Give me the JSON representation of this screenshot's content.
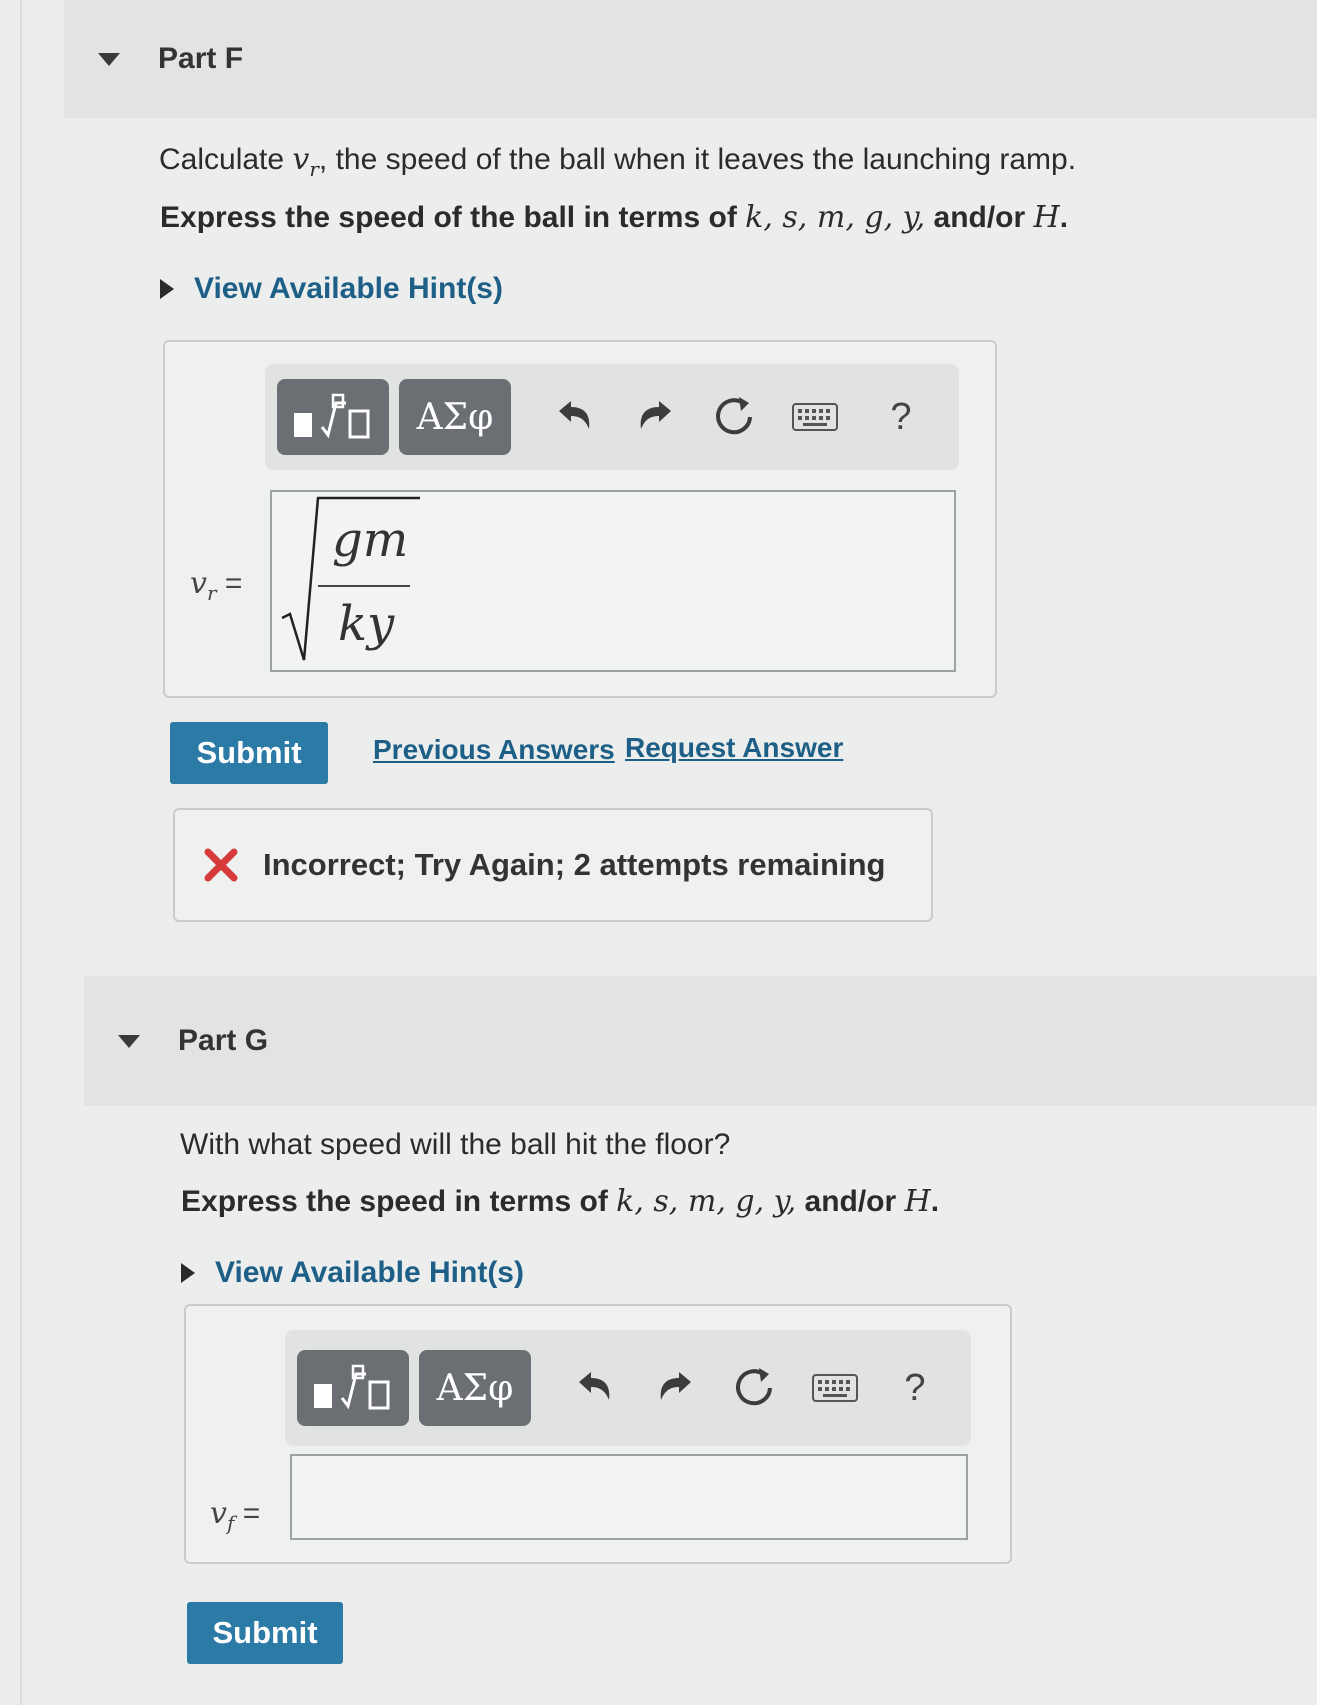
{
  "partF": {
    "title": "Part F",
    "question_prefix": "Calculate ",
    "question_var": "v",
    "question_var_sub": "r",
    "question_suffix": ", the speed of the ball when it leaves the launching ramp.",
    "express_prefix": "Express the speed of the ball in terms of ",
    "express_vars": "k, s, m, g, y,",
    "express_andor": " and/or ",
    "express_last": "H",
    "express_period": ".",
    "hint_label": "View Available Hint(s)",
    "templates_label": "Templates",
    "greek_label": "ΑΣφ",
    "help_label": "?",
    "answer_var": "v",
    "answer_sub": "r",
    "answer_eq": " =",
    "answer_numerator": "gm",
    "answer_denominator": "ky",
    "submit_label": "Submit",
    "previous_answers_label": "Previous Answers",
    "request_answer_label": "Request Answer",
    "feedback_message": "Incorrect; Try Again; 2 attempts remaining"
  },
  "partG": {
    "title": "Part G",
    "question": "With what speed will the ball hit the floor?",
    "express_prefix": "Express the speed in terms of ",
    "express_vars": "k, s, m, g, y,",
    "express_andor": " and/or ",
    "express_last": "H",
    "express_period": ".",
    "hint_label": "View Available Hint(s)",
    "templates_label": "Templates",
    "greek_label": "ΑΣφ",
    "help_label": "?",
    "answer_var": "v",
    "answer_sub": "f",
    "answer_eq": " =",
    "answer_value": "",
    "submit_label": "Submit"
  },
  "colors": {
    "accent": "#2c7aa6",
    "link": "#1d5f86",
    "error": "#d63a3a",
    "toolbar_button": "#6b6f73"
  },
  "icons": [
    "collapse-triangle-icon",
    "hint-expand-icon",
    "templates-icon",
    "undo-icon",
    "redo-icon",
    "reset-icon",
    "keyboard-icon",
    "help-icon",
    "incorrect-x-icon"
  ]
}
